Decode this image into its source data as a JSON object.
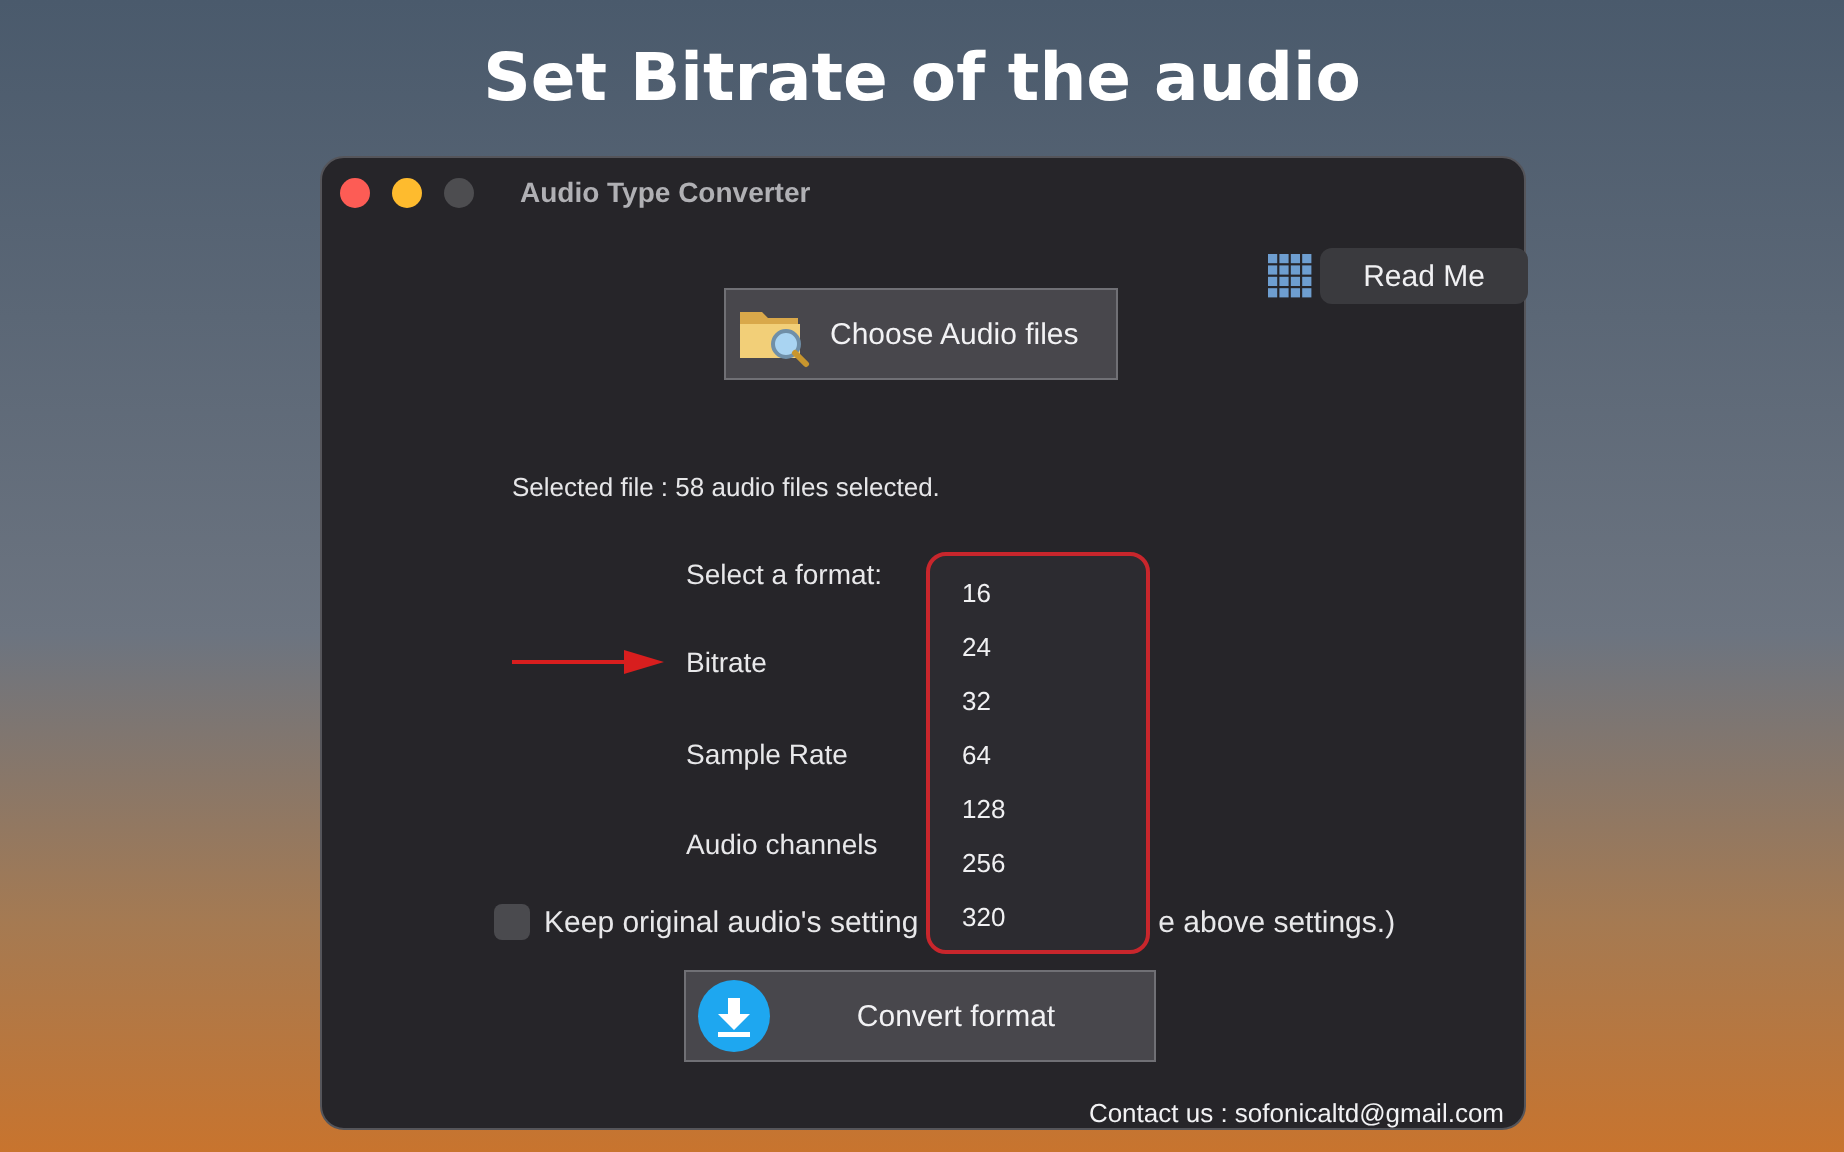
{
  "heading": "Set Bitrate of the audio",
  "window": {
    "title": "Audio Type Converter"
  },
  "read_me_button": "Read Me",
  "choose_button": "Choose Audio files",
  "selected_file": "Selected file : 58 audio files selected.",
  "settings": [
    {
      "label": "Select a format:",
      "pointed": false
    },
    {
      "label": "Bitrate",
      "pointed": true
    },
    {
      "label": "Sample Rate",
      "pointed": false
    },
    {
      "label": "Audio channels",
      "pointed": false
    }
  ],
  "keep_original": {
    "checked": false,
    "label_start": "Keep original audio's setting",
    "label_end": "e above settings.)"
  },
  "bitrate_menu": [
    "16",
    "24",
    "32",
    "64",
    "128",
    "256",
    "320"
  ],
  "convert_button": "Convert format",
  "contact": "Contact us : sofonicaltd@gmail.com"
}
